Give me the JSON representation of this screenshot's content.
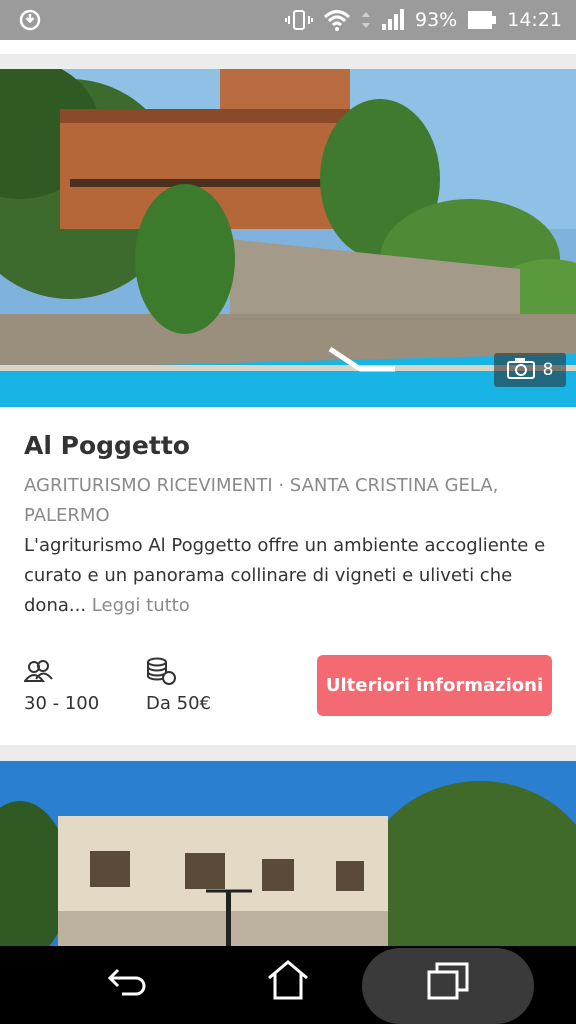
{
  "status_bar": {
    "battery_percent": "93%",
    "time": "14:21",
    "icons": [
      "sync-icon",
      "vibrate-icon",
      "wifi-icon",
      "signal-icon",
      "battery-icon"
    ]
  },
  "listing": {
    "title": "Al Poggetto",
    "category": "AGRITURISMO RICEVIMENTI · SANTA CRISTINA GELA, PALERMO",
    "description": "L'agriturismo Al Poggetto offre un ambiente accogliente e curato e un panorama collinare di vigneti e uliveti che dona...",
    "read_more": "Leggi tutto",
    "photo_count": "8",
    "guests": "30 - 100",
    "price": "Da 50€",
    "cta_label": "Ulteriori informazioni",
    "cta_color": "#f36a72"
  },
  "nav": {
    "buttons": [
      "back-icon",
      "home-icon",
      "recent-apps-icon"
    ]
  }
}
